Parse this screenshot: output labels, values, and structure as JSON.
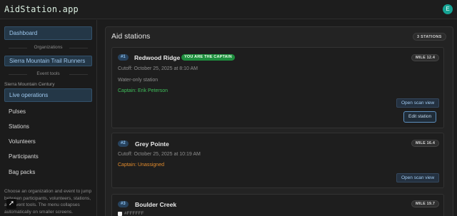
{
  "header": {
    "brand": "AidStation.app",
    "avatar_initial": "E"
  },
  "sidebar": {
    "dashboard_label": "Dashboard",
    "organizations_label": "Organizations",
    "organization_name": "Sierra Mountain Trail Runners",
    "event_tools_label": "Event tools",
    "event_name": "Sierra Mountain Century",
    "live_operations_label": "Live operations",
    "nav_items": [
      "Pulses",
      "Stations",
      "Volunteers",
      "Participants",
      "Bag packs"
    ],
    "help_text": "Choose an organization and event to jump between participants, volunteers, stations, and event tools. The menu collapses automatically on smaller screens."
  },
  "main": {
    "title": "Aid stations",
    "station_count": "3 STATIONS",
    "stations": [
      {
        "number": "#1",
        "name": "Redwood Ridge",
        "captain_badge": "YOU ARE THE CAPTAIN",
        "mile": "MILE 12.4",
        "cutoff": "Cutoff: October 25, 2025 at 8:10 AM",
        "note": "Water-only station",
        "captain": "Captain: Erik Peterson",
        "scan_label": "Open scan view",
        "edit_label": "Edit station"
      },
      {
        "number": "#2",
        "name": "Grey Pointe",
        "mile": "MILE 16.4",
        "cutoff": "Cutoff: October 25, 2025 at 10:19 AM",
        "captain": "Captain: Unassigned",
        "scan_label": "Open scan view"
      },
      {
        "number": "#3",
        "name": "Boulder Creek",
        "mile": "MILE 19.7",
        "color_code": "#FFFFFF"
      }
    ]
  },
  "colors": {
    "accent_blue": "#9ec8ee",
    "captain_assigned": "#3fbf5a",
    "captain_unassigned": "#e08a2c",
    "brand_avatar": "#16a394"
  }
}
